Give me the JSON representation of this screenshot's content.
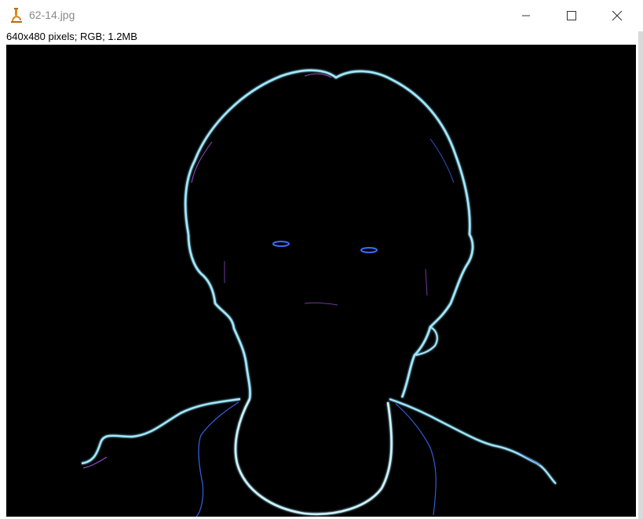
{
  "window": {
    "title": "62-14.jpg",
    "info": "640x480 pixels; RGB; 1.2MB",
    "controls": {
      "minimize_icon": "minimize-icon",
      "maximize_icon": "maximize-icon",
      "close_icon": "close-icon"
    },
    "app_icon": "microscope-icon"
  },
  "image": {
    "description_colors": {
      "background": "#000000",
      "edge_primary": "#9fe8ff",
      "edge_accent_blue": "#3a6bff",
      "edge_accent_magenta": "#c05cff"
    }
  }
}
